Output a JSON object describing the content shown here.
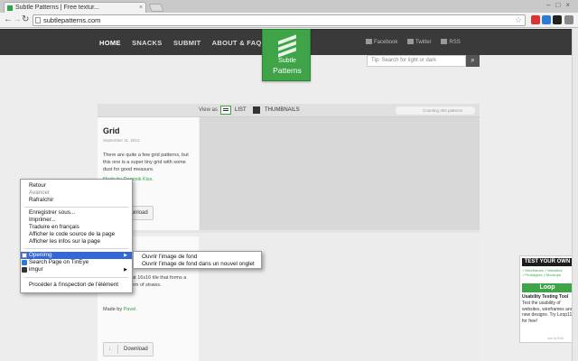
{
  "browser": {
    "tab_title": "Subtle Patterns | Free textur...",
    "tab_close": "×",
    "window_controls": "–□×",
    "url": "subtlepatterns.com",
    "back": "←",
    "forward": "→",
    "reload": "↻"
  },
  "site": {
    "nav": [
      "HOME",
      "SNACKS",
      "SUBMIT",
      "ABOUT & FAQ"
    ],
    "logo_line1": "Subtle",
    "logo_line2": "Patterns",
    "social": [
      "Facebook",
      "Twitter",
      "RSS"
    ],
    "search_placeholder": "Tip: Search for light or dark",
    "search_icon": "magnifier"
  },
  "viewbar": {
    "view_as": "View as",
    "list_label": "LIST",
    "thumbnails_label": "THUMBNAILS",
    "counting": "Counting 384 patterns"
  },
  "pattern1": {
    "title": "Grid",
    "date": "September 11, 2012",
    "description": "There are quite a few grid patterns, but this one is a super tiny grid with some dust for good measure.",
    "by": "Made by Dominik Kiss.",
    "download": "Download"
  },
  "pattern2": {
    "description": "Made of a neat 16x16 tile that forms a beautiful pattern of straws.",
    "by_prefix": "Made by",
    "by_name": "Pavel.",
    "download": "Download"
  },
  "context_menu": {
    "items": [
      "Retour",
      "Avancer",
      "Rafraîchir",
      "Enregistrer sous...",
      "Imprimer...",
      "Traduire en français",
      "Afficher le code source de la page",
      "Afficher les infos sur la page",
      "Openimg",
      "Search Page on TinEye",
      "imgur",
      "Procéder à l'inspection de l'élément"
    ],
    "submenu": [
      "Ouvrir l'image de fond",
      "Ouvrir l'image de fond dans un nouvel onglet"
    ],
    "arrow": "▶"
  },
  "ad": {
    "headline": "TEST YOUR OWN",
    "checks": "✓Wireframes ✓Websites ✓Prototypes ✓Mockups",
    "brand": "Loop",
    "title": "Usability Testing Tool",
    "body": "Test the usability of websites, wireframes and new designs. Try Loop11 for free!",
    "credit": "ads by BSA"
  },
  "colors": {
    "accent": "#3ea447",
    "header": "#3a3a3a",
    "highlight": "#3468d9"
  }
}
